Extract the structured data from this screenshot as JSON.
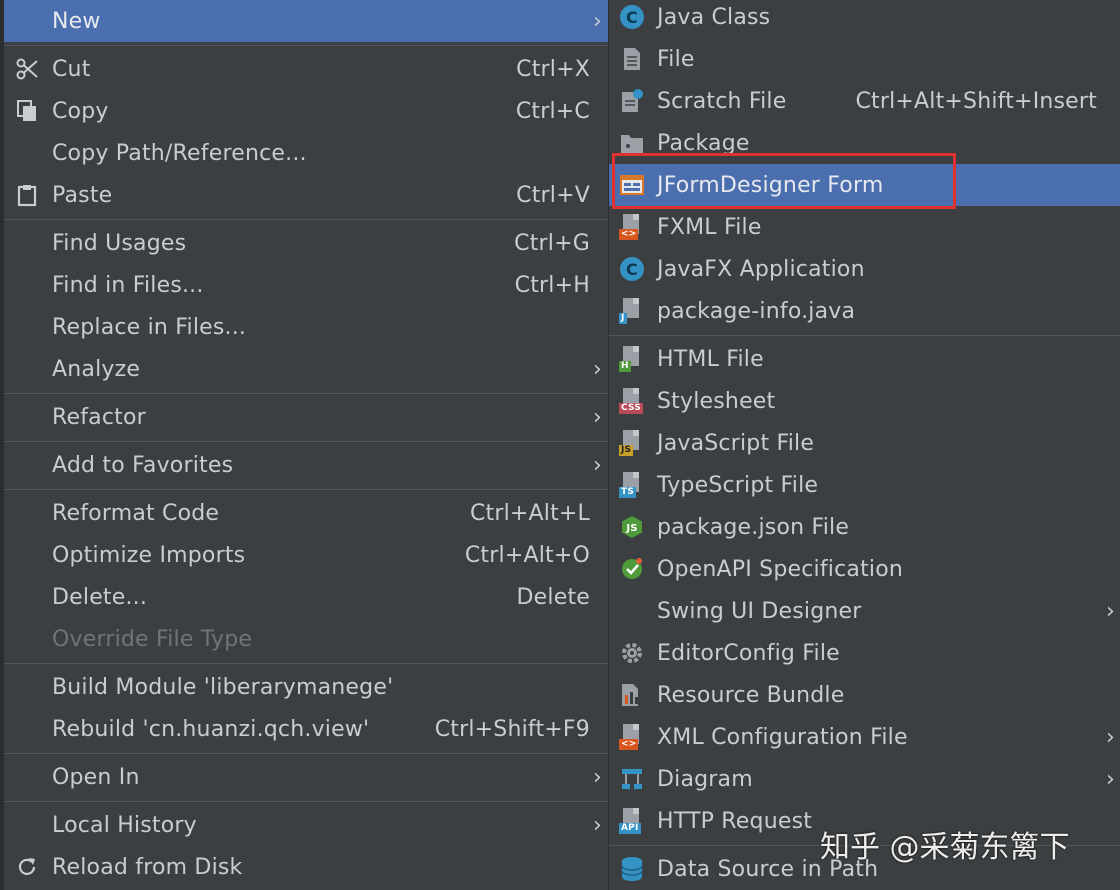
{
  "left_menu": {
    "new": {
      "label": "New"
    },
    "cut": {
      "label": "Cut",
      "shortcut": "Ctrl+X"
    },
    "copy": {
      "label": "Copy",
      "shortcut": "Ctrl+C"
    },
    "copy_path": {
      "label": "Copy Path/Reference..."
    },
    "paste": {
      "label": "Paste",
      "shortcut": "Ctrl+V"
    },
    "find_usages": {
      "label": "Find Usages",
      "shortcut": "Ctrl+G"
    },
    "find_in_files": {
      "label": "Find in Files...",
      "shortcut": "Ctrl+H"
    },
    "replace_in_files": {
      "label": "Replace in Files..."
    },
    "analyze": {
      "label": "Analyze"
    },
    "refactor": {
      "label": "Refactor"
    },
    "add_to_favorites": {
      "label": "Add to Favorites"
    },
    "reformat_code": {
      "label": "Reformat Code",
      "shortcut": "Ctrl+Alt+L"
    },
    "optimize_imports": {
      "label": "Optimize Imports",
      "shortcut": "Ctrl+Alt+O"
    },
    "delete": {
      "label": "Delete...",
      "shortcut": "Delete"
    },
    "override_file_type": {
      "label": "Override File Type"
    },
    "build_module": {
      "label": "Build Module 'liberarymanege'"
    },
    "rebuild": {
      "label": "Rebuild 'cn.huanzi.qch.view'",
      "shortcut": "Ctrl+Shift+F9"
    },
    "open_in": {
      "label": "Open In"
    },
    "local_history": {
      "label": "Local History"
    },
    "reload_from_disk": {
      "label": "Reload from Disk"
    }
  },
  "right_menu": {
    "java_class": {
      "label": "Java Class"
    },
    "file": {
      "label": "File"
    },
    "scratch_file": {
      "label": "Scratch File",
      "shortcut": "Ctrl+Alt+Shift+Insert"
    },
    "package": {
      "label": "Package"
    },
    "jformdesigner_form": {
      "label": "JFormDesigner Form"
    },
    "fxml_file": {
      "label": "FXML File"
    },
    "javafx_application": {
      "label": "JavaFX Application"
    },
    "package_info": {
      "label": "package-info.java"
    },
    "html_file": {
      "label": "HTML File"
    },
    "stylesheet": {
      "label": "Stylesheet"
    },
    "javascript_file": {
      "label": "JavaScript File"
    },
    "typescript_file": {
      "label": "TypeScript File"
    },
    "package_json": {
      "label": "package.json File"
    },
    "openapi": {
      "label": "OpenAPI Specification"
    },
    "swing_ui_designer": {
      "label": "Swing UI Designer"
    },
    "editorconfig": {
      "label": "EditorConfig File"
    },
    "resource_bundle": {
      "label": "Resource Bundle"
    },
    "xml_config": {
      "label": "XML Configuration File"
    },
    "diagram": {
      "label": "Diagram"
    },
    "http_request": {
      "label": "HTTP Request"
    },
    "data_source": {
      "label": "Data Source in Path"
    }
  },
  "icons": {
    "c_badge": "C",
    "html_badge": "H",
    "css_badge": "CSS",
    "js_badge": "JS",
    "ts_badge": "TS",
    "api_badge": "API",
    "j_badge": "J",
    "xml_badge": "<>"
  },
  "colors": {
    "menu_bg": "#3c3f41",
    "selection": "#4b6eaf",
    "highlight_box": "#e03030"
  },
  "watermark": "知乎 @采菊东篱下"
}
